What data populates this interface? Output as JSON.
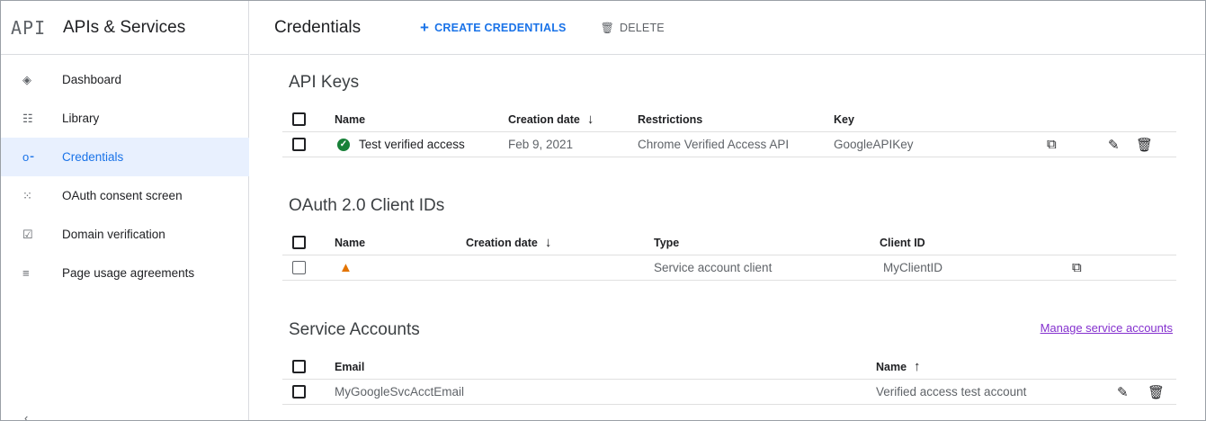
{
  "sidebar": {
    "logo": "API",
    "title": "APIs & Services",
    "items": [
      {
        "label": "Dashboard",
        "icon": "◈"
      },
      {
        "label": "Library",
        "icon": "☷"
      },
      {
        "label": "Credentials",
        "icon": "o⁃"
      },
      {
        "label": "OAuth consent screen",
        "icon": "⁙"
      },
      {
        "label": "Domain verification",
        "icon": "☑"
      },
      {
        "label": "Page usage agreements",
        "icon": "≡"
      }
    ],
    "bottom_icon": "‹"
  },
  "toolbar": {
    "title": "Credentials",
    "create_icon": "+",
    "create_label": "CREATE CREDENTIALS",
    "delete_icon": "🗑",
    "delete_label": "DELETE"
  },
  "api_keys": {
    "title": "API Keys",
    "headers": {
      "name": "Name",
      "creation_date": "Creation date",
      "restrictions": "Restrictions",
      "key": "Key"
    },
    "rows": [
      {
        "name": "Test verified access",
        "creation_date": "Feb 9, 2021",
        "restrictions": "Chrome Verified Access API",
        "key": "GoogleAPIKey"
      }
    ]
  },
  "oauth": {
    "title": "OAuth 2.0 Client IDs",
    "headers": {
      "name": "Name",
      "creation_date": "Creation date",
      "type": "Type",
      "client_id": "Client ID"
    },
    "rows": [
      {
        "name": "",
        "creation_date": "",
        "type": "Service account client",
        "client_id": "MyClientID"
      }
    ]
  },
  "service_accounts": {
    "title": "Service Accounts",
    "manage_link": "Manage service accounts",
    "headers": {
      "email": "Email",
      "name": "Name"
    },
    "rows": [
      {
        "email": "MyGoogleSvcAcctEmail",
        "name": "Verified access test account"
      }
    ]
  },
  "icons": {
    "sort_down": "↓",
    "sort_up": "↑",
    "check": "✓",
    "warning": "▲",
    "copy": "⧉",
    "edit": "✎",
    "trash": "🗑"
  },
  "colors": {
    "accent": "#1a73e8",
    "active_bg": "#e8f0fe",
    "success": "#188038",
    "warning": "#e37400",
    "link_visited": "#8430ce"
  }
}
